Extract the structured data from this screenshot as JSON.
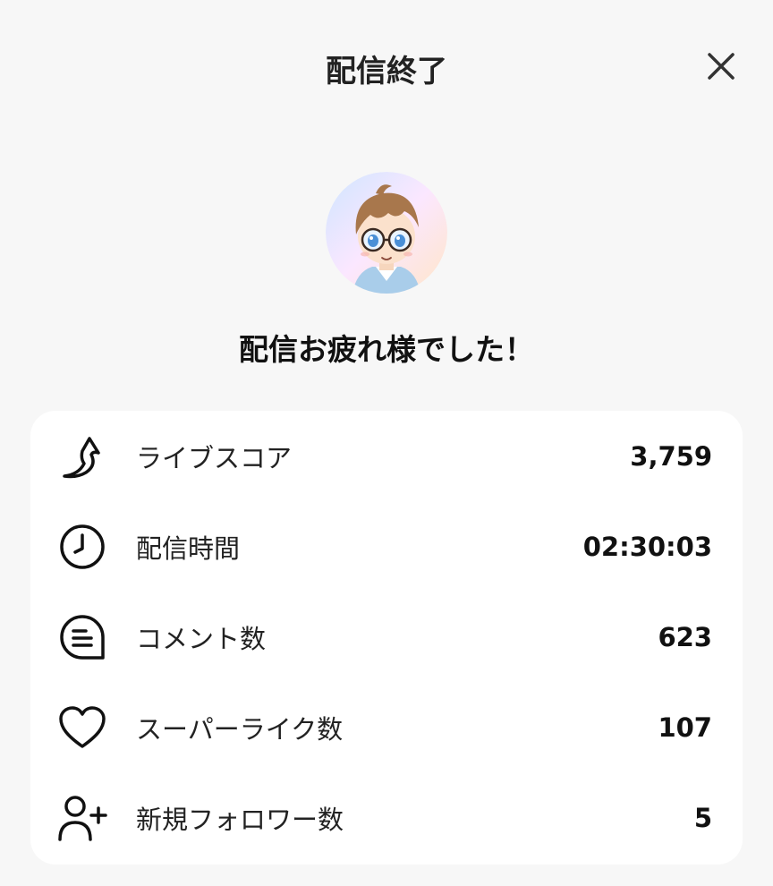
{
  "header": {
    "title": "配信終了"
  },
  "message": "配信お疲れ様でした！",
  "stats": [
    {
      "icon": "live-score-icon",
      "label": "ライブスコア",
      "value": "3,759"
    },
    {
      "icon": "clock-icon",
      "label": "配信時間",
      "value": "02:30:03"
    },
    {
      "icon": "comment-icon",
      "label": "コメント数",
      "value": "623"
    },
    {
      "icon": "heart-icon",
      "label": "スーパーライク数",
      "value": "107"
    },
    {
      "icon": "add-user-icon",
      "label": "新規フォロワー数",
      "value": "5"
    }
  ],
  "colors": {
    "background": "#f7f7f7",
    "card": "#ffffff",
    "text": "#111111"
  }
}
